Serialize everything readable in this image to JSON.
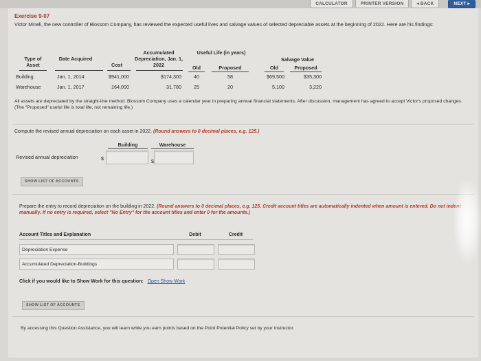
{
  "nav": {
    "calculator": "CALCULATOR",
    "printer": "PRINTER VERSION",
    "back": "◂ BACK",
    "next": "NEXT ▸"
  },
  "exercise": {
    "title": "Exercise 9-07",
    "intro": "Victor Mineli, the new controller of Blossom Company, has reviewed the expected useful lives and salvage values of selected depreciable assets at the beginning of 2022. Here are his findings:"
  },
  "table": {
    "headers": {
      "type": "Type of Asset",
      "date": "Date Acquired",
      "cost": "Cost",
      "accum": "Accumulated Depreciation, Jan. 1, 2022",
      "life": "Useful Life (in years)",
      "life_old": "Old",
      "life_proposed": "Proposed",
      "salvage": "Salvage Value",
      "salvage_old": "Old",
      "salvage_proposed": "Proposed"
    },
    "rows": [
      {
        "type": "Building",
        "date": "Jan. 1, 2014",
        "cost": "$941,000",
        "accum": "$174,300",
        "life_old": "40",
        "life_proposed": "58",
        "salvage_old": "$69,500",
        "salvage_proposed": "$35,300"
      },
      {
        "type": "Warehouse",
        "date": "Jan. 1, 2017",
        "cost": "164,000",
        "accum": "31,780",
        "life_old": "25",
        "life_proposed": "20",
        "salvage_old": "5,100",
        "salvage_proposed": "3,220"
      }
    ]
  },
  "note": "All assets are depreciated by the straight-line method. Blossom Company uses a calendar year in preparing annual financial statements. After discussion, management has agreed to accept Victor's proposed changes. (The \"Proposed\" useful life is total life, not remaining life.)",
  "part1": {
    "instruction": "Compute the revised annual depreciation on each asset in 2022.",
    "instruction_hint": "(Round answers to 0 decimal places, e.g. 125.)",
    "col_building": "Building",
    "col_warehouse": "Warehouse",
    "row_label": "Revised annual depreciation",
    "currency": "$",
    "building_value": "",
    "warehouse_value": "",
    "show_list": "SHOW LIST OF ACCOUNTS"
  },
  "part2": {
    "instruction": "Prepare the entry to record depreciation on the building in 2022.",
    "instruction_hint": "(Round answers to 0 decimal places, e.g. 125. Credit account titles are automatically indented when amount is entered. Do not indent manually. If no entry is required, select \"No Entry\" for the account titles and enter 0 for the amounts.)",
    "col_account": "Account Titles and Explanation",
    "col_debit": "Debit",
    "col_credit": "Credit",
    "entries": [
      {
        "account": "Depreciation Expense",
        "debit": "",
        "credit": ""
      },
      {
        "account": "Accumulated Depreciation-Buildings",
        "debit": "",
        "credit": ""
      }
    ],
    "show_work_prompt": "Click if you would like to Show Work for this question:",
    "show_work_link": "Open Show Work",
    "show_list": "SHOW LIST OF ACCOUNTS"
  },
  "footer": "By accessing this Question Assistance, you will learn while you earn points based on the Point Potential Policy set by your instructor."
}
